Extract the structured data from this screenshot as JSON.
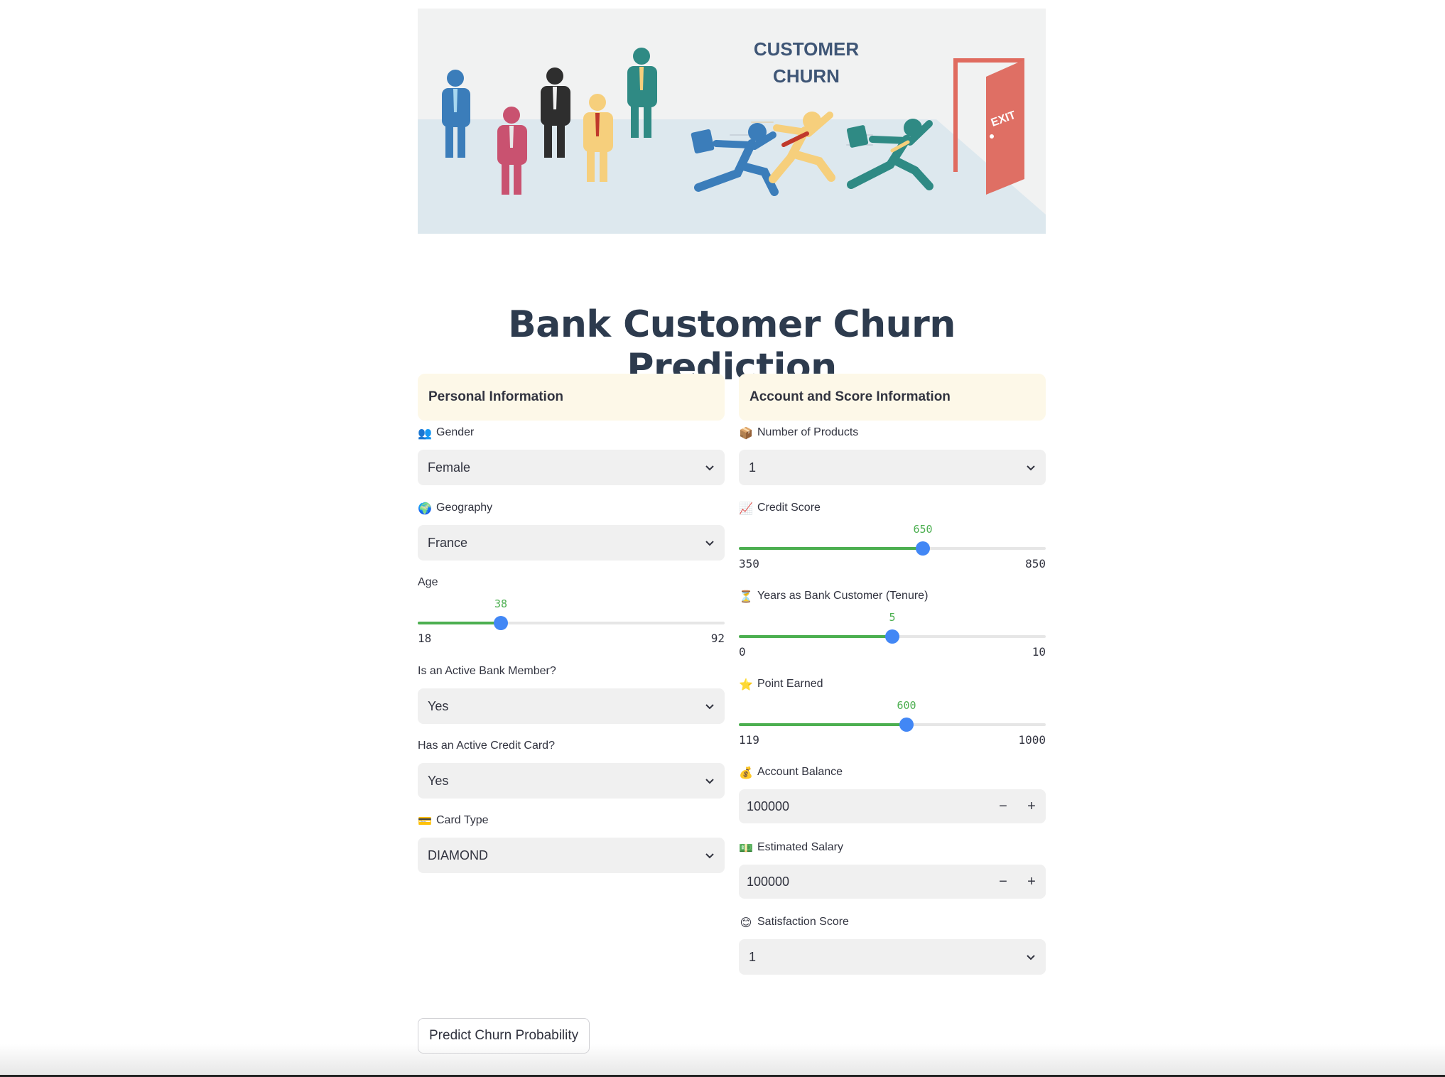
{
  "banner": {
    "heading_line1": "CUSTOMER",
    "heading_line2": "CHURN",
    "door_sign": "EXIT"
  },
  "page_title": "Bank Customer Churn Prediction",
  "personal": {
    "header": "Personal Information",
    "gender": {
      "icon": "people-icon",
      "label": "Gender",
      "value": "Female"
    },
    "geography": {
      "icon": "globe-icon",
      "label": "Geography",
      "value": "France"
    },
    "age": {
      "label": "Age",
      "value": "38",
      "min": "18",
      "max": "92",
      "fraction": 0.27
    },
    "active_member": {
      "label": "Is an Active Bank Member?",
      "value": "Yes"
    },
    "credit_card": {
      "label": "Has an Active Credit Card?",
      "value": "Yes"
    },
    "card_type": {
      "icon": "credit-card-icon",
      "label": "Card Type",
      "value": "DIAMOND"
    }
  },
  "account": {
    "header": "Account and Score Information",
    "products": {
      "icon": "package-icon",
      "label": "Number of Products",
      "value": "1"
    },
    "credit_score": {
      "icon": "chart-up-icon",
      "label": "Credit Score",
      "value": "650",
      "min": "350",
      "max": "850",
      "fraction": 0.6
    },
    "tenure": {
      "icon": "hourglass-icon",
      "label": "Years as Bank Customer (Tenure)",
      "value": "5",
      "min": "0",
      "max": "10",
      "fraction": 0.5
    },
    "points": {
      "icon": "star-icon",
      "label": "Point Earned",
      "value": "600",
      "min": "119",
      "max": "1000",
      "fraction": 0.546
    },
    "balance": {
      "icon": "money-bag-icon",
      "label": "Account Balance",
      "value": "100000"
    },
    "salary": {
      "icon": "banknote-icon",
      "label": "Estimated Salary",
      "value": "100000"
    },
    "satisfaction": {
      "icon": "smile-icon",
      "label": "Satisfaction Score",
      "value": "1"
    }
  },
  "stepper": {
    "minus": "−",
    "plus": "+"
  },
  "predict_button": "Predict Churn Probability",
  "colors": {
    "accent": "#4287f5",
    "slider_fill": "#4caf50",
    "header_bg": "#fdf8e8",
    "title": "#2d3b4e"
  }
}
